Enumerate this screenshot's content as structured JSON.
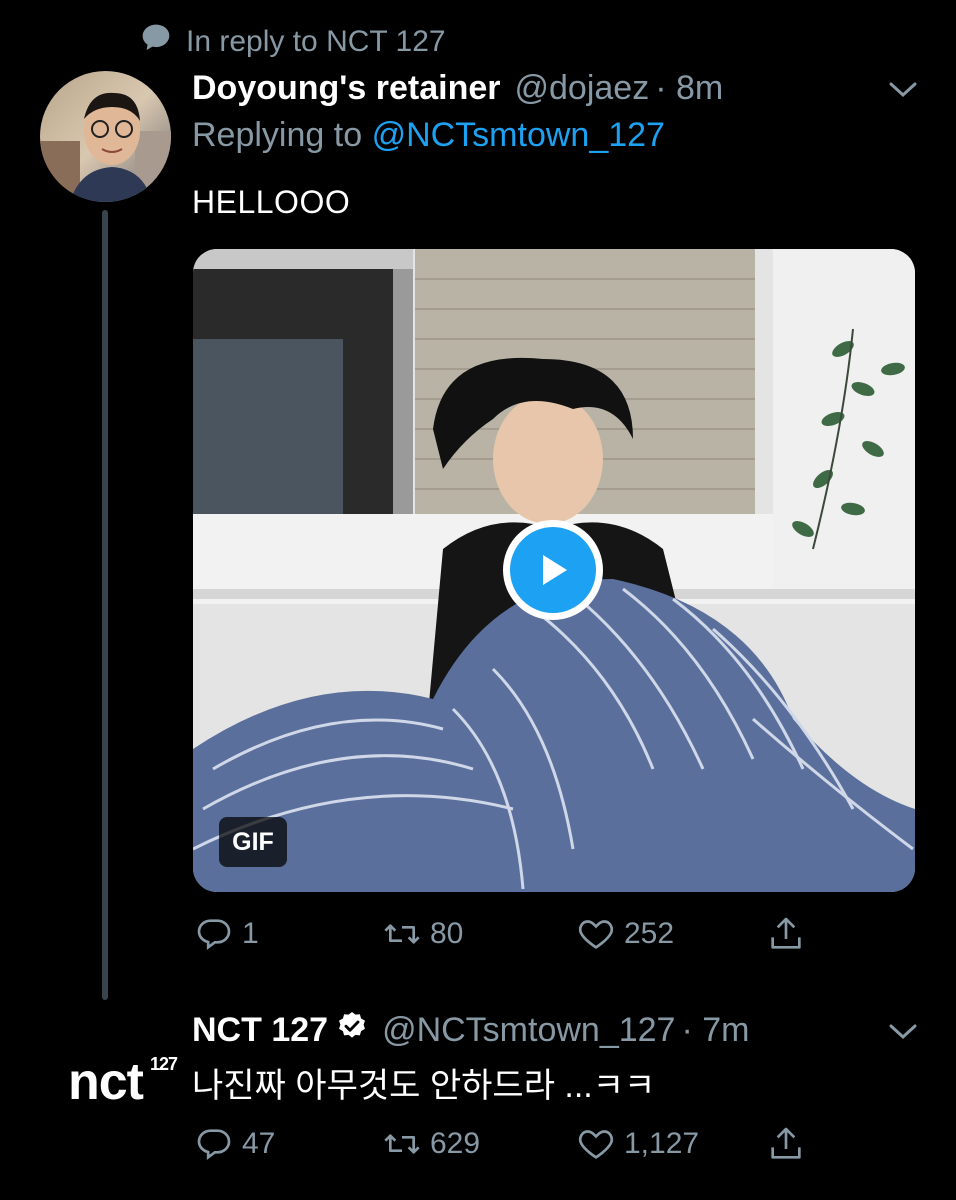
{
  "context": {
    "text": "In reply to NCT 127"
  },
  "tweet1": {
    "display_name": "Doyoung's retainer",
    "handle": "@dojaez",
    "time": "· 8m",
    "replying_prefix": "Replying to",
    "replying_handle": "@NCTsmtown_127",
    "text": "HELLOOO",
    "media_badge": "GIF",
    "replies": "1",
    "retweets": "80",
    "likes": "252"
  },
  "tweet2": {
    "display_name": "NCT 127",
    "handle": "@NCTsmtown_127",
    "time": "· 7m",
    "text": "나진짜 아무것도 안하드라 ...ㅋㅋ",
    "avatar_logo": "nct",
    "avatar_logo_sup": "127",
    "replies": "47",
    "retweets": "629",
    "likes": "1,127"
  },
  "colors": {
    "background": "#000000",
    "secondary": "#8899a6",
    "accent": "#1da1f2"
  },
  "icons": [
    "speech-bubble-icon",
    "chevron-down-icon",
    "reply-icon",
    "retweet-icon",
    "like-icon",
    "share-icon",
    "verified-icon",
    "play-icon"
  ]
}
